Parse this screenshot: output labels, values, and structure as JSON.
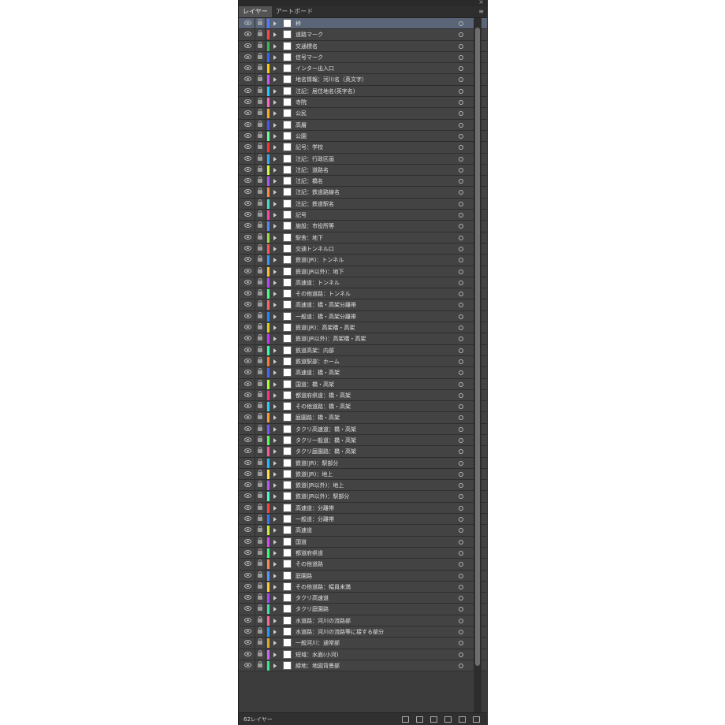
{
  "panel": {
    "close_glyph": "×",
    "tabs": [
      "レイヤー",
      "アートボード"
    ],
    "menu_glyph": "≡",
    "layer_count": "62レイヤー",
    "icons": {
      "visibility": "eye-icon",
      "lock": "lock-icon",
      "expand": "expand-triangle-icon",
      "target": "target-circle-icon"
    }
  },
  "layers": [
    {
      "name": "枠",
      "color": "#5577ff",
      "selected": true
    },
    {
      "name": "道路マーク",
      "color": "#ff4444"
    },
    {
      "name": "交通標名",
      "color": "#33bb55"
    },
    {
      "name": "信号マーク",
      "color": "#3366ff"
    },
    {
      "name": "インター出入口",
      "color": "#ffcc00"
    },
    {
      "name": "地名情報：河川名（英文字）",
      "color": "#cc55ff"
    },
    {
      "name": "注記：居住地名(英字名)",
      "color": "#22ccff"
    },
    {
      "name": "寺院",
      "color": "#ff66cc"
    },
    {
      "name": "公民",
      "color": "#ffaa22"
    },
    {
      "name": "高層",
      "color": "#4455ff"
    },
    {
      "name": "公園",
      "color": "#66ff99"
    },
    {
      "name": "記号：学校",
      "color": "#ff3333"
    },
    {
      "name": "注記：行政区画",
      "color": "#33aaff"
    },
    {
      "name": "注記：道路名",
      "color": "#ccff33"
    },
    {
      "name": "注記：橋名",
      "color": "#aa55ff"
    },
    {
      "name": "注記：鉄道路線名",
      "color": "#ff8844"
    },
    {
      "name": "注記：鉄道駅名",
      "color": "#44ddcc"
    },
    {
      "name": "記号",
      "color": "#ff44aa"
    },
    {
      "name": "施設：市役所等",
      "color": "#5588ff"
    },
    {
      "name": "駅舎：地下",
      "color": "#99dd44"
    },
    {
      "name": "交通トンネル口",
      "color": "#ff5555"
    },
    {
      "name": "鉄道(JR)：トンネル",
      "color": "#3399ff"
    },
    {
      "name": "鉄道(JR以外)：地下",
      "color": "#ffbb33"
    },
    {
      "name": "高速道：トンネル",
      "color": "#bb44ff"
    },
    {
      "name": "その他道路：トンネル",
      "color": "#44ff88"
    },
    {
      "name": "高速道：橋・高架分離帯",
      "color": "#ff6666"
    },
    {
      "name": "一般道：橋・高架分離帯",
      "color": "#2288ff"
    },
    {
      "name": "鉄道(JR)：高架橋・高架",
      "color": "#ddcc22"
    },
    {
      "name": "鉄道(JR以外)：高架橋・高架",
      "color": "#cc33ff"
    },
    {
      "name": "鉄道高架：内部",
      "color": "#33ffaa"
    },
    {
      "name": "鉄道駅部：ホーム",
      "color": "#ff7733"
    },
    {
      "name": "高速道：橋・高架",
      "color": "#4466ff"
    },
    {
      "name": "国道：橋・高架",
      "color": "#aaff33"
    },
    {
      "name": "都道府県道：橋・高架",
      "color": "#ff3388"
    },
    {
      "name": "その他道路：橋・高架",
      "color": "#33ccff"
    },
    {
      "name": "庭園路：橋・高架",
      "color": "#ff9933"
    },
    {
      "name": "タクリ高速道：橋・高架",
      "color": "#7755ff"
    },
    {
      "name": "タクリ一般道：橋・高架",
      "color": "#55ff55"
    },
    {
      "name": "タクリ庭園路：橋・高架",
      "color": "#ff5599"
    },
    {
      "name": "鉄道(JR)：駅部分",
      "color": "#22bbff"
    },
    {
      "name": "鉄道(JR)：地上",
      "color": "#ffdd44"
    },
    {
      "name": "鉄道(JR以外)：地上",
      "color": "#bb55ff"
    },
    {
      "name": "鉄道(JR以外)：駅部分",
      "color": "#44ffcc"
    },
    {
      "name": "高速道：分離帯",
      "color": "#ff4444"
    },
    {
      "name": "一般道：分離帯",
      "color": "#3377ff"
    },
    {
      "name": "高速道",
      "color": "#ccee33"
    },
    {
      "name": "国道",
      "color": "#dd44ff"
    },
    {
      "name": "都道府県道",
      "color": "#33ff77"
    },
    {
      "name": "その他道路",
      "color": "#ff8855"
    },
    {
      "name": "庭園路",
      "color": "#5599ff"
    },
    {
      "name": "その他道路：幅員未満",
      "color": "#ffcc33"
    },
    {
      "name": "タクリ高速道",
      "color": "#aa44ff"
    },
    {
      "name": "タクリ庭園路",
      "color": "#44ddaa"
    },
    {
      "name": "水道路：河川の流路部",
      "color": "#ff6699"
    },
    {
      "name": "水道路：河川の流路等に接する部分",
      "color": "#2299ff"
    },
    {
      "name": "一般河川：通常部",
      "color": "#ddaa22"
    },
    {
      "name": "短域：水面(小河)",
      "color": "#cc66ff"
    },
    {
      "name": "緑地：地図背景部",
      "color": "#33ee88"
    }
  ]
}
